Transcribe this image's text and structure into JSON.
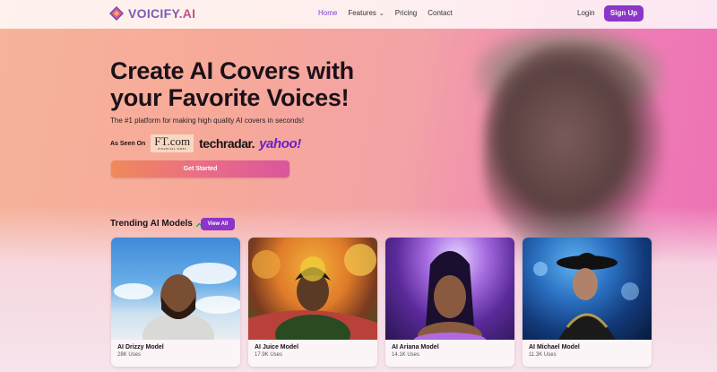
{
  "brand": {
    "name_main": "VOICIFY",
    "name_suffix": ".AI",
    "accent": "#8b35c9"
  },
  "nav": {
    "links": [
      {
        "label": "Home",
        "active": true
      },
      {
        "label": "Features",
        "active": false
      },
      {
        "label": "Pricing",
        "active": false
      },
      {
        "label": "Contact",
        "active": false
      }
    ],
    "login": "Login",
    "signup": "Sign Up"
  },
  "hero": {
    "title": "Create AI Covers with your Favorite Voices!",
    "subtitle": "The #1 platform for making high quality AI covers in seconds!",
    "as_seen_on": "As Seen On",
    "press": {
      "ft_main": "FT.com",
      "ft_small": "FINANCIAL TIMES",
      "techradar": "techradar.",
      "yahoo": "yahoo!"
    },
    "cta": "Get Started"
  },
  "trending": {
    "title": "Trending AI Models",
    "view_all": "View All",
    "models": [
      {
        "name": "AI Drizzy Model",
        "uses": "28K Uses"
      },
      {
        "name": "AI Juice Model",
        "uses": "17.9K Uses"
      },
      {
        "name": "AI Ariana Model",
        "uses": "14.1K Uses"
      },
      {
        "name": "AI Michael Model",
        "uses": "11.3K Uses"
      }
    ]
  }
}
